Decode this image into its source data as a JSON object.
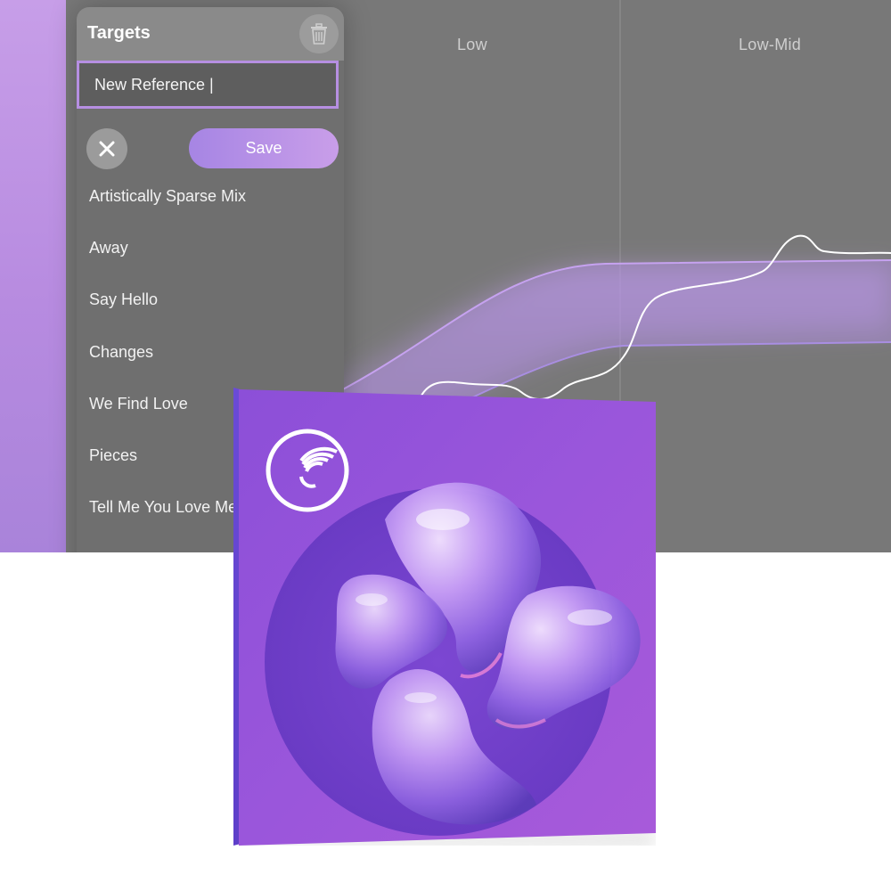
{
  "eq": {
    "bands": [
      "Low",
      "Low-Mid"
    ]
  },
  "targets_panel": {
    "title": "Targets",
    "delete_icon": "trash-icon",
    "input_value": "New Reference |",
    "cancel_icon": "close-icon",
    "save_label": "Save",
    "items": [
      "Artistically Sparse Mix",
      "Away",
      "Say Hello",
      "Changes",
      "We Find Love",
      "Pieces",
      "Tell Me You Love Me"
    ]
  },
  "product": {
    "logo_icon": "ozone-logo-icon",
    "artwork": "glass-blob-artwork"
  },
  "colors": {
    "accent_purple": "#a98be4",
    "panel_gray": "#6f6f6f",
    "background_gray": "#787878",
    "box_purple": "#9a52d6"
  }
}
